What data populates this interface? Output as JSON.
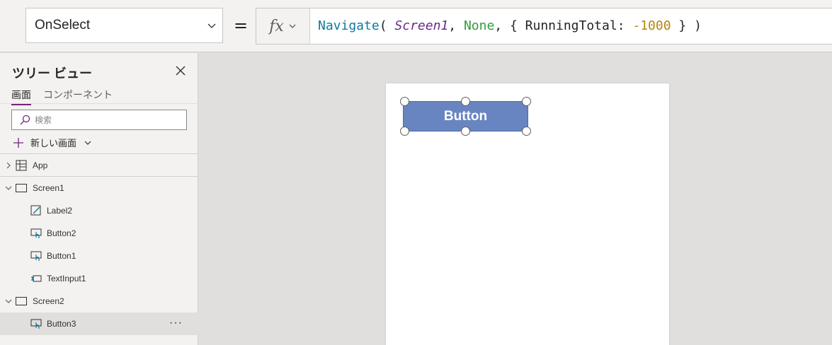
{
  "formula_bar": {
    "property": "OnSelect",
    "equals": "=",
    "fx_label": "fx",
    "formula": {
      "fn": "Navigate",
      "open": "( ",
      "param1": "Screen1",
      "comma1": ", ",
      "param2": "None",
      "comma2": ", { RunningTotal: ",
      "num": "-1000",
      "close": " } )"
    }
  },
  "tree": {
    "title": "ツリー ビュー",
    "tabs": [
      {
        "label": "画面",
        "active": true
      },
      {
        "label": "コンポーネント",
        "active": false
      }
    ],
    "search_placeholder": "検索",
    "new_screen_label": "新しい画面",
    "nodes": [
      {
        "label": "App",
        "icon": "app-icon",
        "expander": "chevron-right"
      },
      {
        "label": "Screen1",
        "icon": "screen-icon",
        "expander": "chevron-down"
      },
      {
        "label": "Label2",
        "icon": "label-icon"
      },
      {
        "label": "Button2",
        "icon": "button-icon"
      },
      {
        "label": "Button1",
        "icon": "button-icon"
      },
      {
        "label": "TextInput1",
        "icon": "text-input-icon"
      },
      {
        "label": "Screen2",
        "icon": "screen-icon",
        "expander": "chevron-down"
      },
      {
        "label": "Button3",
        "icon": "button-icon",
        "selected": true,
        "more": "···"
      }
    ]
  },
  "canvas": {
    "button_label": "Button"
  },
  "colors": {
    "accent": "#742774",
    "button_fill": "#6985c1",
    "fn_token": "#0e7a9e",
    "enum_token": "#2e9c3c",
    "number_token": "#b7860b",
    "param_token": "#6b2a8a"
  }
}
